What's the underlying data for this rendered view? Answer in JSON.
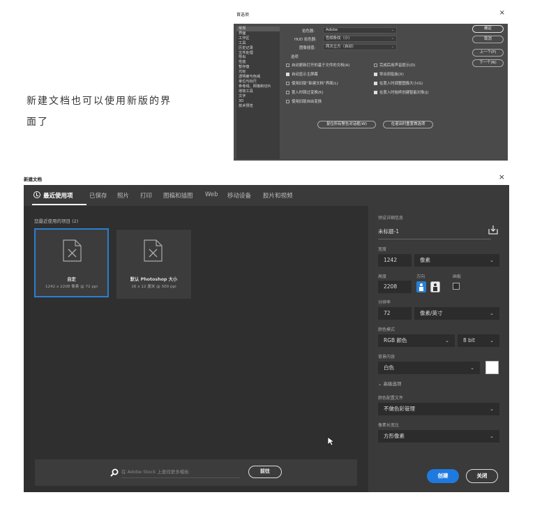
{
  "caption": {
    "line1": "新建文档也可以使用新版的界",
    "line2": "面了"
  },
  "preferences": {
    "title": "首选项",
    "close": "×",
    "nav": [
      "常规",
      "界面",
      "工作区",
      "工具",
      "历史记录",
      "文件处理",
      "导出",
      "性能",
      "暂存盘",
      "光标",
      "透明度与色域",
      "单位与标尺",
      "参考线、网格和切片",
      "增效工具",
      "文字",
      "3D",
      "技术预览"
    ],
    "picker_label": "拾色器:",
    "picker_value": "Adobe",
    "hud_label": "HUD 拾色器:",
    "hud_value": "色相条纹（小）",
    "interp_label": "图像插值:",
    "interp_value": "两次立方（自动）",
    "options_label": "选项",
    "options_left": [
      {
        "label": "自动更新打开的基于文件的文档(A)",
        "checked": false
      },
      {
        "label": "自动显示主屏幕",
        "checked": true
      },
      {
        "label": "使用旧版“新建文档”界面(L)",
        "checked": false
      },
      {
        "label": "置入时跳过变换(K)",
        "checked": false
      },
      {
        "label": "使用旧版自由变换",
        "checked": false
      }
    ],
    "options_right": [
      {
        "label": "完成后用声音提示(D)",
        "checked": false
      },
      {
        "label": "导出剪贴板(X)",
        "checked": true
      },
      {
        "label": "在置入时调整图像大小(G)",
        "checked": true
      },
      {
        "label": "在置入时始终创建智能对象(J)",
        "checked": true
      }
    ],
    "reset_warnings": "复位所有警告对话框(W)",
    "reset_on_quit": "在退出时重置首选项",
    "buttons": [
      "确定",
      "取消",
      "上一个(P)",
      "下一个(N)"
    ]
  },
  "newdoc": {
    "title": "新建文档",
    "close": "×",
    "tabs": [
      "最近使用项",
      "已保存",
      "照片",
      "打印",
      "图稿和插图",
      "Web",
      "移动设备",
      "胶片和视频"
    ],
    "recent_label": "您最近使用的项目 (2)",
    "cards": [
      {
        "name": "自定",
        "meta": "1242 x 2208 像素 @ 72 ppi"
      },
      {
        "name": "默认 Photoshop 大小",
        "meta": "16 x 12 厘米 @ 300 ppi"
      }
    ],
    "search_placeholder": "在 Adobe Stock 上查找更多模板",
    "goto": "前往",
    "details": {
      "preset_label": "预设详细信息",
      "doc_name": "未标题-1",
      "width_label": "宽度",
      "width_value": "1242",
      "width_unit": "像素",
      "height_label": "高度",
      "height_value": "2208",
      "orientation_label": "方向",
      "artboard_label": "画板",
      "resolution_label": "分辨率",
      "resolution_value": "72",
      "resolution_unit": "像素/英寸",
      "color_mode_label": "颜色模式",
      "color_mode_value": "RGB 颜色",
      "bit_depth": "8 bit",
      "bg_label": "背景内容",
      "bg_value": "白色",
      "advanced": "高级选项",
      "profile_label": "颜色配置文件",
      "profile_value": "不做色彩管理",
      "aspect_label": "像素长宽比",
      "aspect_value": "方形像素"
    },
    "create": "创建",
    "close_btn": "关闭"
  }
}
